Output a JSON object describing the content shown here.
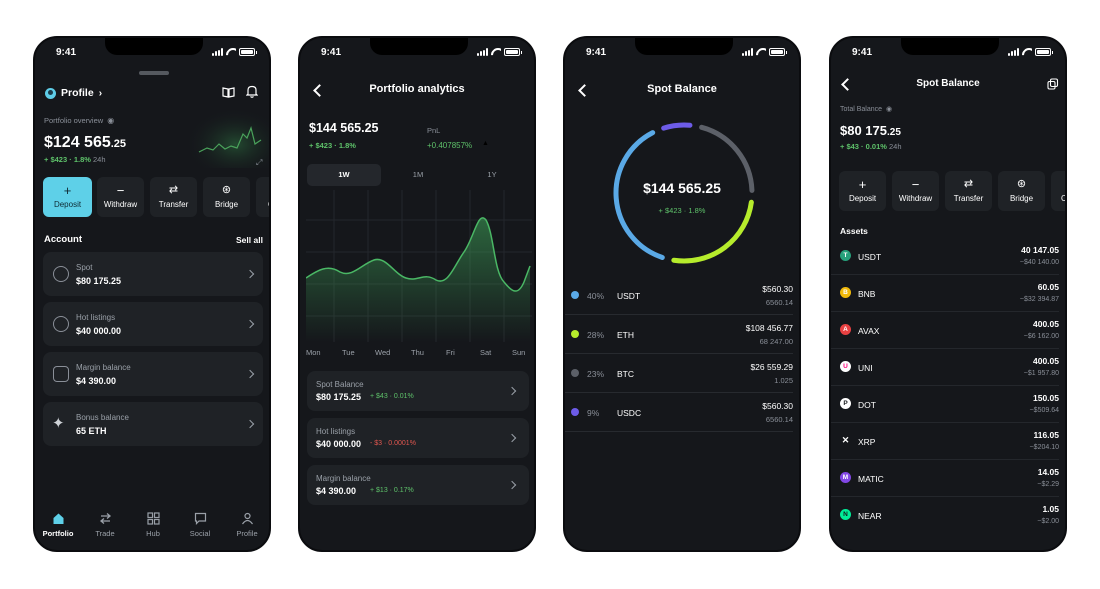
{
  "status": {
    "time": "9:41"
  },
  "screen1": {
    "profile_label": "Profile",
    "overview_label": "Portfolio overview",
    "balance_main": "$124 565",
    "balance_cents": ".25",
    "change": "+ $423 · 1.8%",
    "change_period": "24h",
    "actions": [
      {
        "label": "Deposit",
        "icon": "plus-icon"
      },
      {
        "label": "Withdraw",
        "icon": "minus-icon"
      },
      {
        "label": "Transfer",
        "icon": "transfer-icon"
      },
      {
        "label": "Bridge",
        "icon": "bridge-icon"
      },
      {
        "label": "C",
        "icon": "more-icon"
      }
    ],
    "account_title": "Account",
    "sell_all": "Sell all",
    "accounts": [
      {
        "label": "Spot",
        "value": "$80 175.25",
        "icon": "coins-icon"
      },
      {
        "label": "Hot listings",
        "value": "$40 000.00",
        "icon": "smile-icon"
      },
      {
        "label": "Margin balance",
        "value": "$4 390.00",
        "icon": "calendar-icon"
      },
      {
        "label": "Bonus balance",
        "value": "65 ETH",
        "icon": "sparkle-icon"
      }
    ],
    "nav": [
      {
        "label": "Portfolio",
        "icon": "home-icon",
        "active": true
      },
      {
        "label": "Trade",
        "icon": "swap-icon"
      },
      {
        "label": "Hub",
        "icon": "grid-icon"
      },
      {
        "label": "Social",
        "icon": "chat-icon"
      },
      {
        "label": "Profile",
        "icon": "user-icon"
      }
    ]
  },
  "screen2": {
    "title": "Portfolio analytics",
    "balance": "$144 565.25",
    "change": "+ $423 · 1.8%",
    "pnl_label": "PnL",
    "pnl_value": "+0.407857%",
    "timeframes": [
      "1W",
      "1M",
      "1Y"
    ],
    "active_timeframe": "1W",
    "days": [
      "Mon",
      "Tue",
      "Wed",
      "Thu",
      "Fri",
      "Sat",
      "Sun"
    ],
    "rows": [
      {
        "label": "Spot Balance",
        "value": "$80 175.25",
        "delta": "+ $43 · 0.01%",
        "delta_color": "#5ec26a"
      },
      {
        "label": "Hot listings",
        "value": "$40 000.00",
        "delta": "- $3 · 0.0001%",
        "delta_color": "#e0574f"
      },
      {
        "label": "Margin balance",
        "value": "$4 390.00",
        "delta": "+ $13 · 0.17%",
        "delta_color": "#5ec26a"
      }
    ]
  },
  "screen3": {
    "title": "Spot Balance",
    "total": "$144 565.25",
    "change": "+ $423 · 1.8%",
    "holdings": [
      {
        "pct": "40%",
        "name": "USDT",
        "value": "$560.30",
        "amount": "6560.14",
        "color": "#5aa9e6"
      },
      {
        "pct": "28%",
        "name": "ETH",
        "value": "$108 456.77",
        "amount": "68 247.00",
        "color": "#b6ec2c"
      },
      {
        "pct": "23%",
        "name": "BTC",
        "value": "$26 559.29",
        "amount": "1.025",
        "color": "#5c6068"
      },
      {
        "pct": "9%",
        "name": "USDC",
        "value": "$560.30",
        "amount": "6560.14",
        "color": "#6d5ce8"
      }
    ]
  },
  "screen4": {
    "title": "Spot Balance",
    "total_label": "Total Balance",
    "balance_main": "$80 175",
    "balance_cents": ".25",
    "change": "+ $43 · 0.01%",
    "change_period": "24h",
    "actions": [
      {
        "label": "Deposit",
        "icon": "plus-icon"
      },
      {
        "label": "Withdraw",
        "icon": "minus-icon"
      },
      {
        "label": "Transfer",
        "icon": "transfer-icon"
      },
      {
        "label": "Bridge",
        "icon": "bridge-icon"
      },
      {
        "label": "C",
        "icon": "more-icon"
      }
    ],
    "assets_title": "Assets",
    "assets": [
      {
        "name": "USDT",
        "amount": "40 147.05",
        "value": "~$40 140.00",
        "color": "#26a17b",
        "glyph": "T"
      },
      {
        "name": "BNB",
        "amount": "60.05",
        "value": "~$32 394.87",
        "color": "#f0b90b",
        "glyph": "B"
      },
      {
        "name": "AVAX",
        "amount": "400.05",
        "value": "~$6 162.00",
        "color": "#e84142",
        "glyph": "A"
      },
      {
        "name": "UNI",
        "amount": "400.05",
        "value": "~$1 957.80",
        "color": "#ffffff",
        "glyph": "U"
      },
      {
        "name": "DOT",
        "amount": "150.05",
        "value": "~$509.64",
        "color": "#ffffff",
        "glyph": "P"
      },
      {
        "name": "XRP",
        "amount": "116.05",
        "value": "~$204.10",
        "color": "#15171b",
        "glyph": "✕"
      },
      {
        "name": "MATIC",
        "amount": "14.05",
        "value": "~$2.29",
        "color": "#8247e5",
        "glyph": "M"
      },
      {
        "name": "NEAR",
        "amount": "1.05",
        "value": "~$2.00",
        "color": "#00ec97",
        "glyph": "N"
      }
    ]
  }
}
